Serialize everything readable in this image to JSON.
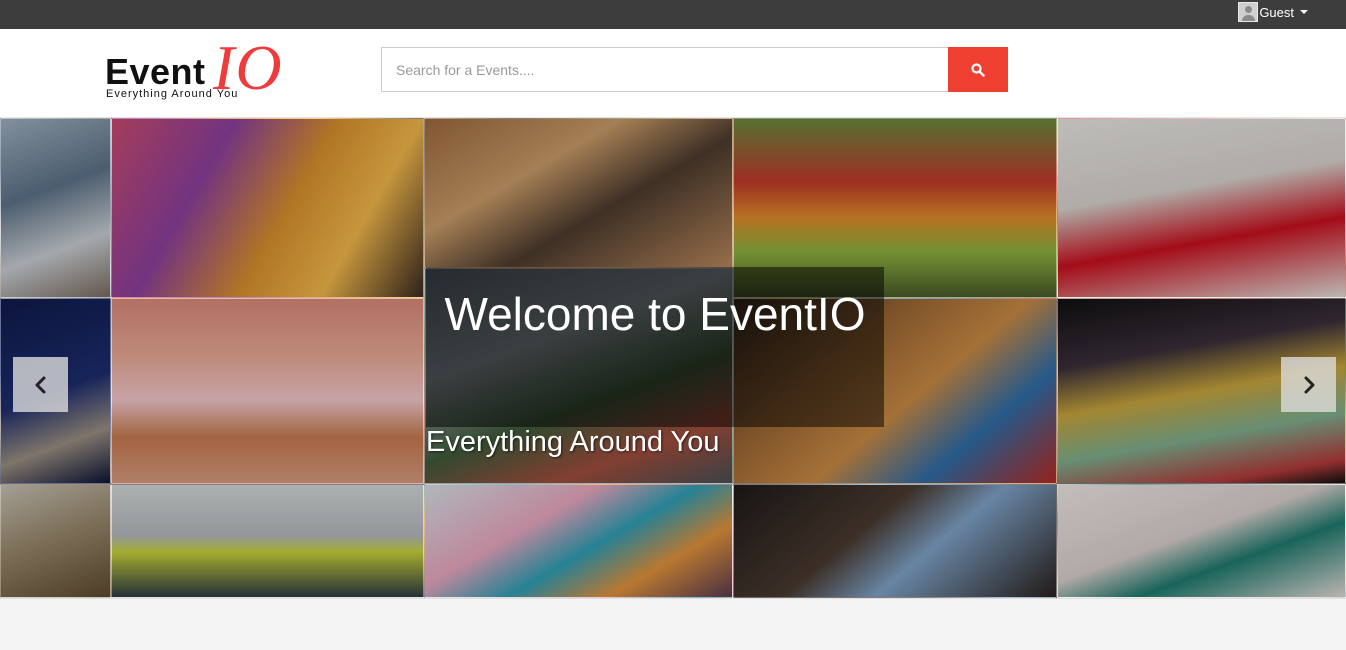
{
  "topbar": {
    "user_label": "Guest",
    "user_icon": "avatar-icon",
    "dropdown_icon": "caret-down-icon"
  },
  "header": {
    "logo_event": "Event",
    "logo_io": "IO",
    "logo_tagline": "Everything Around You",
    "search_placeholder": "Search for a Events....",
    "search_icon": "search-icon"
  },
  "carousel": {
    "title": "Welcome to EventIO",
    "subtitle": "Everything Around You",
    "prev_icon": "chevron-left-icon",
    "next_icon": "chevron-right-icon"
  },
  "colors": {
    "topbar": "#3d3d3d",
    "accent": "#ee3f31",
    "logo_io": "#ee3b3b"
  }
}
